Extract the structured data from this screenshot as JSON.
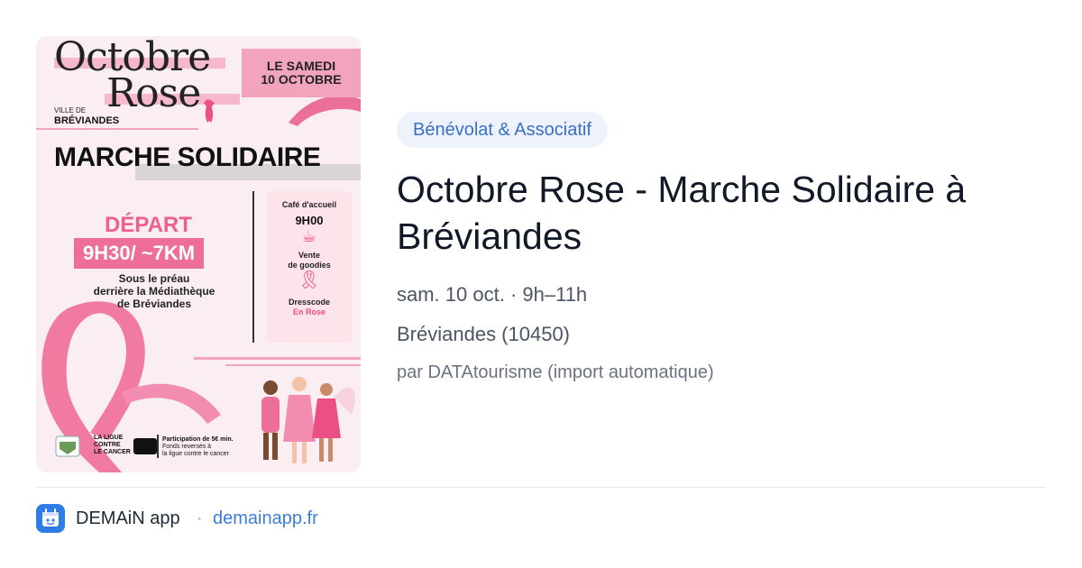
{
  "colors": {
    "accent_blue": "#3a6fc6",
    "category_bg": "#eef3fb",
    "poster_pink": "#f2a4bd",
    "poster_ribbon": "#ec4f84"
  },
  "poster": {
    "title_line1": "Octobre",
    "title_line2": "Rose",
    "ville_label": "VILLE DE",
    "town": "BRÉVIANDES",
    "date_line1": "LE SAMEDI",
    "date_line2": "10 OCTOBRE",
    "headline": "MARCHE SOLIDAIRE",
    "depart": "DÉPART",
    "time_distance": "9H30/ ~7KM",
    "place_line1": "Sous le préau",
    "place_line2": "derrière la Médiathèque",
    "place_line3": "de Bréviandes",
    "cafe_label": "Café d'accueil",
    "cafe_time": "9H00",
    "goodies_line1": "Vente",
    "goodies_line2": "de goodies",
    "dresscode_label": "Dresscode",
    "dresscode_value": "En Rose",
    "ligue_line1": "LA LIGUE",
    "ligue_line2": "CONTRE",
    "ligue_line3": "LE CANCER",
    "participation_line1": "Participation de 5€ min.",
    "participation_line2": "Fonds reversés à",
    "participation_line3": "la ligue contre le cancer",
    "icons": [
      "coffee-cup-icon",
      "pink-ribbon-icon"
    ]
  },
  "event": {
    "category": "Bénévolat & Associatif",
    "title": "Octobre Rose - Marche Solidaire à Bréviandes",
    "date": "sam. 10 oct. · 9h–11h",
    "location": "Bréviandes (10450)",
    "source": "par DATAtourisme (import automatique)"
  },
  "footer": {
    "app_name": "DEMAiN app",
    "separator": "·",
    "domain": "demainapp.fr",
    "icon": "demain-app-icon"
  }
}
